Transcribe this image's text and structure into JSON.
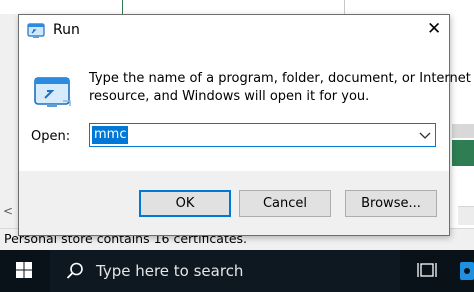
{
  "background_window": {
    "status_text": "Personal store contains 16 certificates.",
    "scroll_left_arrow": "<"
  },
  "dialog": {
    "title": "Run",
    "close_glyph": "✕",
    "prompt_line1": "Type the name of a program, folder, document, or Internet",
    "prompt_line2": "resource, and Windows will open it for you.",
    "open_label": "Open:",
    "open_value": "mmc",
    "buttons": {
      "ok": "OK",
      "cancel": "Cancel",
      "browse": "Browse..."
    }
  },
  "taskbar": {
    "search_placeholder": "Type here to search"
  },
  "colors": {
    "accent": "#0078d7",
    "taskbar": "#0a1219",
    "dialog_footer": "#f0f0f0"
  }
}
